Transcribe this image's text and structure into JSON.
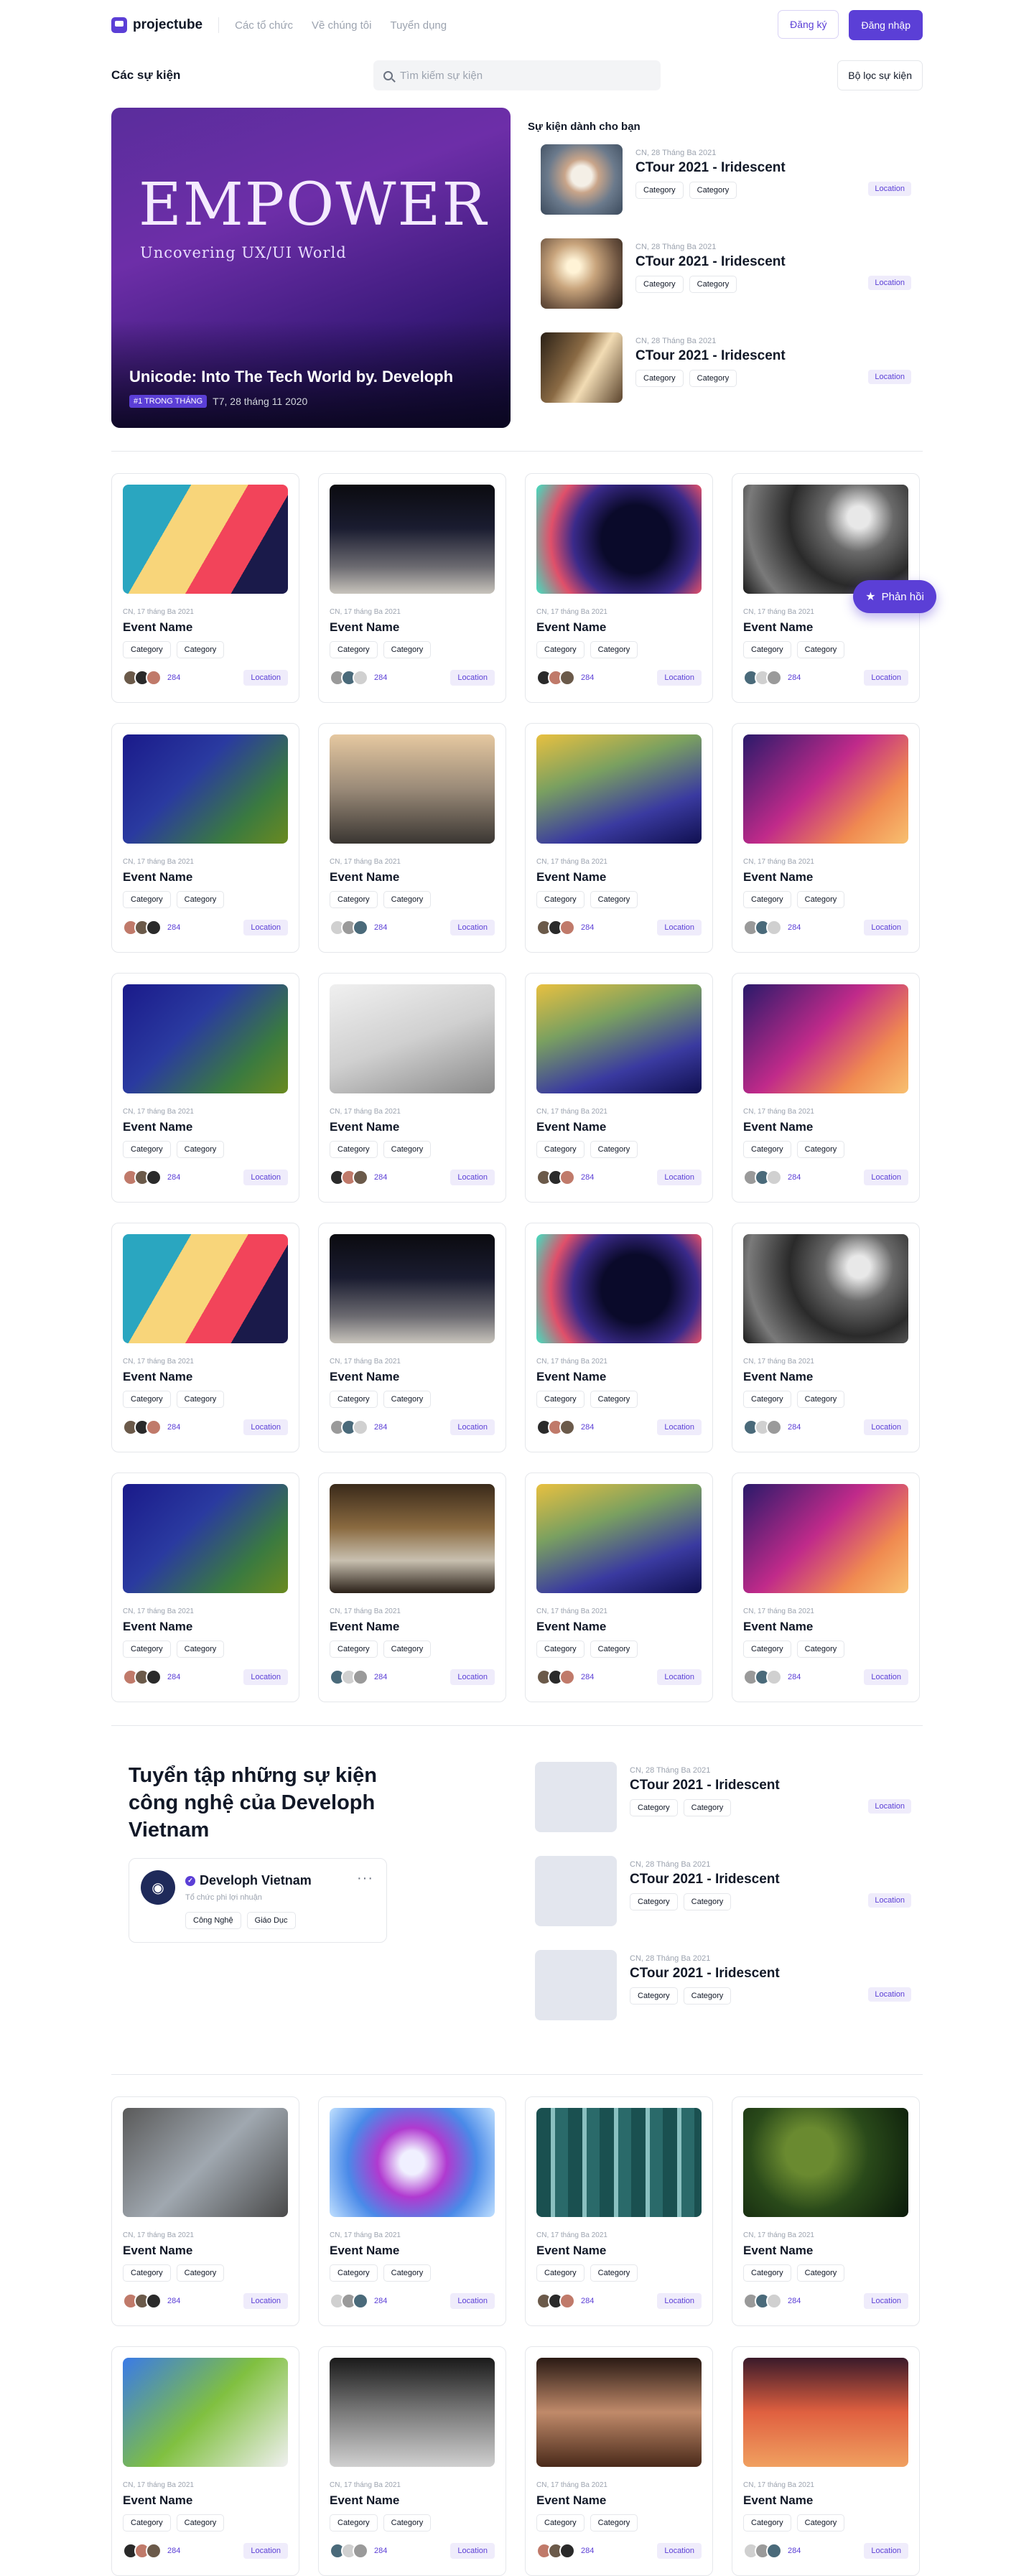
{
  "header": {
    "logo": "projectube",
    "nav": [
      "Các tổ chức",
      "Về chúng tôi",
      "Tuyển dụng"
    ],
    "signup": "Đăng ký",
    "login": "Đăng nhập"
  },
  "toolbar": {
    "title": "Các sự kiện",
    "search_placeholder": "Tìm kiếm sự kiện",
    "filter": "Bộ lọc sự kiện"
  },
  "hero": {
    "big": "EMPOWER",
    "sub": "Uncovering UX/UI World",
    "title": "Unicode: Into The Tech World by. Developh",
    "badge": "#1 TRONG THÁNG",
    "date": "T7, 28 tháng 11 2020"
  },
  "side": {
    "title": "Sự kiện dành cho bạn",
    "items": [
      {
        "date": "CN, 28 Tháng Ba 2021",
        "title": "CTour 2021 - Iridescent",
        "tag1": "Category",
        "tag2": "Category",
        "loc": "Location"
      },
      {
        "date": "CN, 28 Tháng Ba 2021",
        "title": "CTour 2021 - Iridescent",
        "tag1": "Category",
        "tag2": "Category",
        "loc": "Location"
      },
      {
        "date": "CN, 28 Tháng Ba 2021",
        "title": "CTour 2021 - Iridescent",
        "tag1": "Category",
        "tag2": "Category",
        "loc": "Location"
      }
    ]
  },
  "card": {
    "date": "CN, 17 tháng Ba 2021",
    "name": "Event Name",
    "tag": "Category",
    "count": "284",
    "loc": "Location"
  },
  "feedback": "Phản hồi",
  "collection": {
    "title": "Tuyển tập những sự kiện công nghệ của Developh Vietnam",
    "org": "Developh Vietnam",
    "org_sub": "Tổ chức phi lợi nhuận",
    "org_tags": [
      "Công Nghệ",
      "Giáo Dục"
    ],
    "items": [
      {
        "date": "CN, 28 Tháng Ba 2021",
        "title": "CTour 2021 - Iridescent",
        "tag1": "Category",
        "tag2": "Category",
        "loc": "Location"
      },
      {
        "date": "CN, 28 Tháng Ba 2021",
        "title": "CTour 2021 - Iridescent",
        "tag1": "Category",
        "tag2": "Category",
        "loc": "Location"
      },
      {
        "date": "CN, 28 Tháng Ba 2021",
        "title": "CTour 2021 - Iridescent",
        "tag1": "Category",
        "tag2": "Category",
        "loc": "Location"
      }
    ]
  },
  "icons": {
    "search": "search-icon",
    "star": "star-icon",
    "more": "more-icon",
    "rss": "rss-icon"
  }
}
